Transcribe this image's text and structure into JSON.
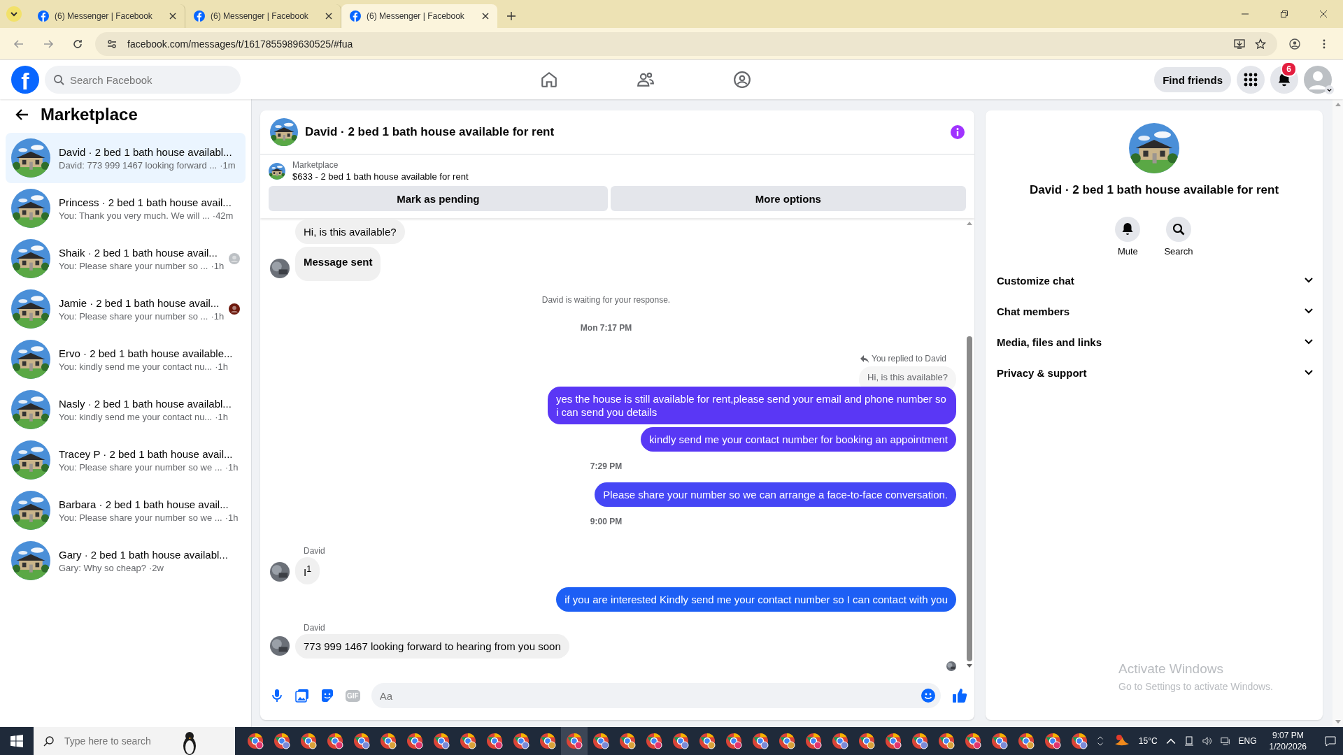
{
  "browser": {
    "tabs": [
      {
        "title": "(6) Messenger | Facebook",
        "selected": false
      },
      {
        "title": "(6) Messenger | Facebook",
        "selected": false
      },
      {
        "title": "(6) Messenger | Facebook",
        "selected": true
      }
    ],
    "url": "facebook.com/messages/t/1617855989630525/#fua"
  },
  "topbar": {
    "logo": "f",
    "search_placeholder": "Search Facebook",
    "find_friends": "Find friends",
    "notification_count": "6"
  },
  "sidebar": {
    "title": "Marketplace",
    "conversations": [
      {
        "title": "David · 2 bed 1 bath house availabl...",
        "preview": "David: 773 999 1467 looking forward ...",
        "time": "·1m",
        "selected": true
      },
      {
        "title": "Princess · 2 bed 1 bath house avail...",
        "preview": "You: Thank you very much. We will ...",
        "time": "·42m",
        "selected": false
      },
      {
        "title": "Shaik · 2 bed 1 bath house avail...",
        "preview": "You: Please share your number so ...",
        "time": "·1h",
        "selected": false,
        "color": "#bcc0c4"
      },
      {
        "title": "Jamie · 2 bed 1 bath house avail...",
        "preview": "You: Please share your number so ...",
        "time": "·1h",
        "selected": false,
        "color": "#6e1a0e"
      },
      {
        "title": "Ervo · 2 bed 1 bath house available...",
        "preview": "You: kindly send me your contact nu...",
        "time": "·1h",
        "selected": false
      },
      {
        "title": "Nasly · 2 bed 1 bath house availabl...",
        "preview": "You: kindly send me your contact nu...",
        "time": "·1h",
        "selected": false
      },
      {
        "title": "Tracey P · 2 bed 1 bath house avail...",
        "preview": "You: Please share your number so we ...",
        "time": "·1h",
        "selected": false
      },
      {
        "title": "Barbara · 2 bed 1 bath house avail...",
        "preview": "You: Please share your number so we ...",
        "time": "·1h",
        "selected": false
      },
      {
        "title": "Gary · 2 bed 1 bath house availabl...",
        "preview": "Gary: Why so cheap?",
        "time": "·2w",
        "selected": false
      }
    ]
  },
  "chat": {
    "title": "David · 2 bed 1 bath house available for rent",
    "listing": {
      "label": "Marketplace",
      "summary": "$633 - 2 bed 1 bath house available for rent"
    },
    "actions": [
      "Mark as pending",
      "More options"
    ],
    "messages": [
      {
        "kind": "incoming",
        "text": "Hi, is this available?",
        "avatar": false,
        "bold": false
      },
      {
        "kind": "incoming",
        "text": "Message sent",
        "avatar": true,
        "bold": true
      },
      {
        "kind": "notice",
        "text": "David is waiting for your response."
      },
      {
        "kind": "timestamp",
        "text": "Mon 7:17 PM"
      },
      {
        "kind": "reply",
        "note": "You replied to David",
        "quoted": "Hi, is this available?"
      },
      {
        "kind": "outgoing",
        "text": "yes the house is still available for rent,please send your email and phone number so i can send you details",
        "color": "#5a37f5"
      },
      {
        "kind": "outgoing",
        "text": "kindly send me your contact number for booking an appointment",
        "color": "#5838f5"
      },
      {
        "kind": "timestamp",
        "text": "7:29 PM"
      },
      {
        "kind": "outgoing",
        "text": "Please share your number so we can arrange a face-to-face conversation.",
        "color": "#4546f5"
      },
      {
        "kind": "timestamp",
        "text": "9:00 PM"
      },
      {
        "kind": "sender",
        "text": "David"
      },
      {
        "kind": "incoming",
        "text": "I$^{1}$",
        "avatar": true,
        "bold": false
      },
      {
        "kind": "outgoing",
        "text": "if you are interested Kindly send me your contact number so I can contact with you",
        "color": "#1d5ff5"
      },
      {
        "kind": "sender",
        "text": "David"
      },
      {
        "kind": "incoming",
        "text": "773 999 1467  looking forward to hearing from you soon",
        "avatar": true,
        "bold": false
      }
    ],
    "composer": {
      "placeholder": "Aa",
      "gif_label": "GIF"
    }
  },
  "details": {
    "title": "David · 2 bed 1 bath house available for rent",
    "actions": [
      {
        "kind": "mute",
        "label": "Mute"
      },
      {
        "kind": "search",
        "label": "Search"
      }
    ],
    "sections": [
      {
        "label": "Customize chat",
        "expanded": false
      },
      {
        "label": "Chat members",
        "expanded": false
      },
      {
        "label": "Media, files and links",
        "expanded": false
      },
      {
        "label": "Privacy & support",
        "expanded": false
      }
    ],
    "activation": {
      "title": "Activate Windows",
      "subtitle": "Go to Settings to activate Windows."
    }
  },
  "taskbar": {
    "search_placeholder": "Type here to search",
    "apps": [
      {
        "selected": false
      },
      {
        "selected": false
      },
      {
        "selected": false
      },
      {
        "selected": false
      },
      {
        "selected": false
      },
      {
        "selected": false
      },
      {
        "selected": false
      },
      {
        "selected": false
      },
      {
        "selected": false
      },
      {
        "selected": false
      },
      {
        "selected": false
      },
      {
        "selected": false
      },
      {
        "selected": true
      },
      {
        "selected": false
      },
      {
        "selected": false
      },
      {
        "selected": false
      },
      {
        "selected": false
      },
      {
        "selected": false
      },
      {
        "selected": false
      },
      {
        "selected": false
      },
      {
        "selected": false
      },
      {
        "selected": false
      },
      {
        "selected": false
      },
      {
        "selected": false
      },
      {
        "selected": false
      },
      {
        "selected": false
      },
      {
        "selected": false
      },
      {
        "selected": false
      },
      {
        "selected": false
      },
      {
        "selected": false
      },
      {
        "selected": false
      },
      {
        "selected": false
      }
    ],
    "temperature": "15°C",
    "language": "ENG",
    "time": "9:07 PM",
    "date": "1/20/2026"
  }
}
